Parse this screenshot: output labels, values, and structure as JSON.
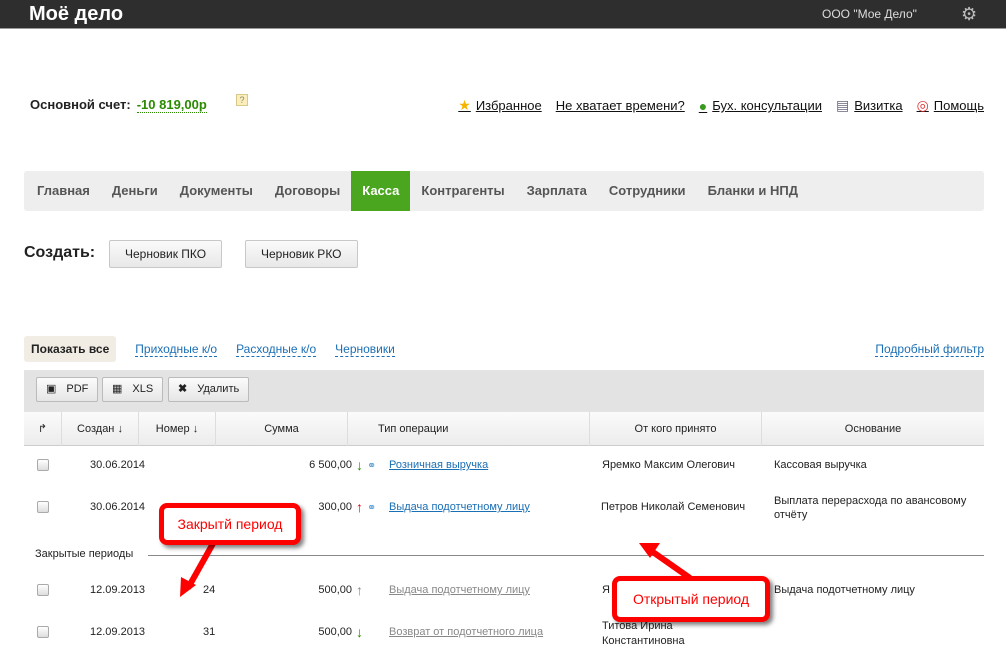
{
  "header": {
    "logo": "Моё дело",
    "org": "ООО \"Мое Дело\""
  },
  "account": {
    "label": "Основной счет:",
    "value": "-10 819,00р",
    "help": "?"
  },
  "links": [
    "Избранное",
    "Не хватает времени?",
    "Бух. консультации",
    "Визитка",
    "Помощь"
  ],
  "nav": [
    "Главная",
    "Деньги",
    "Документы",
    "Договоры",
    "Касса",
    "Контрагенты",
    "Зарплата",
    "Сотрудники",
    "Бланки и НПД"
  ],
  "create": {
    "label": "Создать:",
    "pko": "Черновик ПКО",
    "rko": "Черновик РКО"
  },
  "filters": {
    "all": "Показать все",
    "income": "Приходные к/о",
    "expense": "Расходные к/о",
    "drafts": "Черновики",
    "advanced": "Подробный фильтр"
  },
  "toolbar": {
    "pdf": "PDF",
    "xls": "XLS",
    "delete": "Удалить"
  },
  "columns": [
    "Создан ↓",
    "Номер ↓",
    "Сумма",
    "Тип операции",
    "От кого принято",
    "Основание"
  ],
  "rows": [
    {
      "date": "30.06.2014",
      "num": "",
      "sum": "6 500,00",
      "dir": "↓",
      "type": "Розничная выручка",
      "from": "Яремко Максим Олегович",
      "basis": "Кассовая выручка"
    },
    {
      "date": "30.06.2014",
      "num": "",
      "sum": "300,00",
      "dir": "↑",
      "type": "Выдача подотчетному лицу",
      "from": "Петров Николай Семенович",
      "basis": "Выплата перерасхода по авансовому отчёту"
    },
    {
      "date": "12.09.2013",
      "num": "24",
      "sum": "500,00",
      "dir": "↑",
      "type": "Выдача подотчетному лицу",
      "from": "Я",
      "basis": "Выдача подотчетному лицу"
    },
    {
      "date": "12.09.2013",
      "num": "31",
      "sum": "500,00",
      "dir": "↓",
      "type": "Возврат от подотчетного лица",
      "from": "Титова Ирина Константиновна",
      "basis": ""
    }
  ],
  "closed_label": "Закрытые периоды",
  "callouts": {
    "closed": "Закрытй период",
    "open": "Открытый период"
  }
}
